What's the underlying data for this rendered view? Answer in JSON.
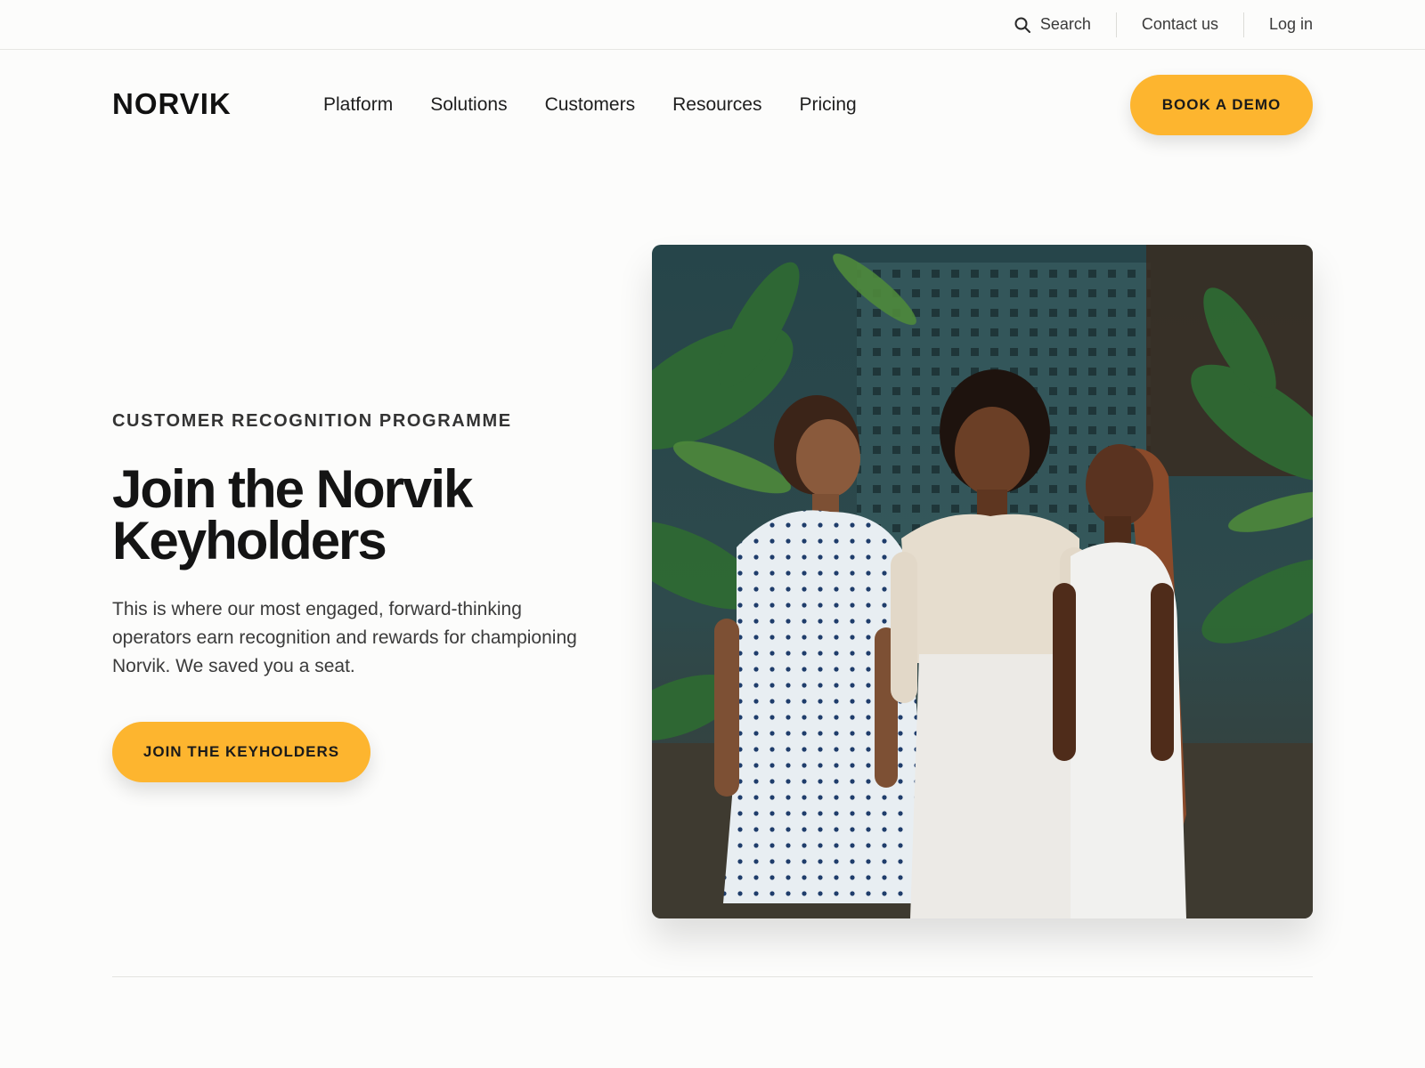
{
  "utility": {
    "search_label": "Search",
    "search_icon": "search-icon",
    "contact_label": "Contact us",
    "login_label": "Log in"
  },
  "nav": {
    "logo": "NORVIK",
    "links": [
      "Platform",
      "Solutions",
      "Customers",
      "Resources",
      "Pricing"
    ],
    "cta": "BOOK A DEMO"
  },
  "hero": {
    "eyebrow": "CUSTOMER RECOGNITION PROGRAMME",
    "title_line1": "Join the Norvik",
    "title_line2": "Keyholders",
    "body": "This is where our most engaged, forward-thinking operators earn recognition and rewards for championing Norvik. We saved you a seat.",
    "cta": "JOIN THE KEYHOLDERS"
  },
  "colors": {
    "accent": "#fdb52f",
    "background": "#fcfcfb",
    "text": "#171717"
  }
}
